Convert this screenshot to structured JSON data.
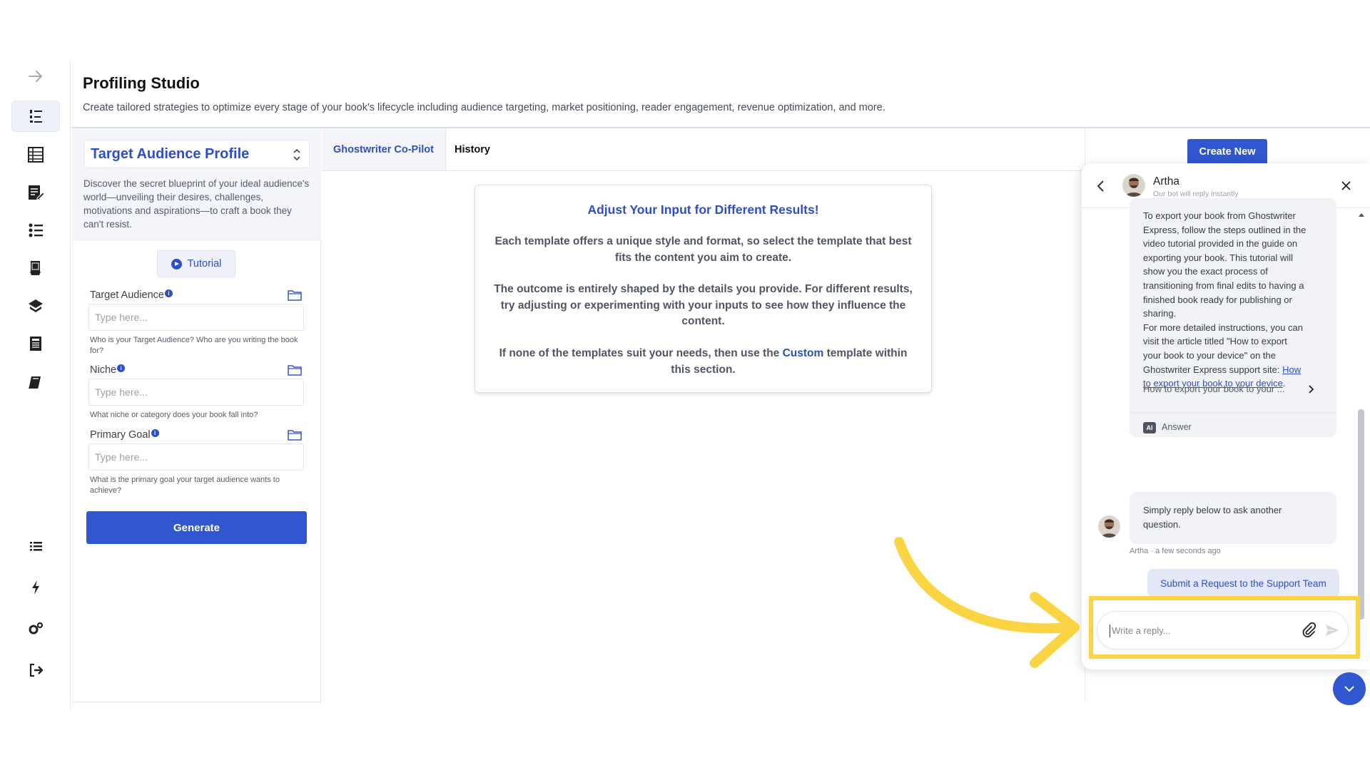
{
  "app": {
    "title": "Profiling Studio",
    "subtitle": "Create tailored strategies to optimize every stage of your book's lifecycle including audience targeting, market positioning, reader engagement, revenue optimization, and more."
  },
  "sidebar": {
    "items": [
      {
        "icon": "arrow-right-icon"
      },
      {
        "icon": "list-ordered-icon",
        "active": true
      },
      {
        "icon": "table-icon"
      },
      {
        "icon": "edit-document-icon"
      },
      {
        "icon": "list-numbered-icon"
      },
      {
        "icon": "book-stand-icon"
      },
      {
        "icon": "notebook-pencil-icon"
      },
      {
        "icon": "newspaper-icon"
      },
      {
        "icon": "book-icon"
      },
      {
        "icon": "list-icon"
      },
      {
        "icon": "lightning-icon"
      },
      {
        "icon": "cogs-icon"
      },
      {
        "icon": "logout-icon"
      }
    ]
  },
  "profile": {
    "selected": "Target Audience Profile",
    "description": "Discover the secret blueprint of your ideal audience's world—unveiling their desires, challenges, motivations and aspirations—to craft a book they can't resist.",
    "tutorial_label": "Tutorial",
    "fields": [
      {
        "label": "Target Audience",
        "placeholder": "Type here...",
        "help": "Who is your Target Audience? Who are you writing the book for?"
      },
      {
        "label": "Niche",
        "placeholder": "Type here...",
        "help": "What niche or category does your book fall into?"
      },
      {
        "label": "Primary Goal",
        "placeholder": "Type here...",
        "help": "What is the primary goal your target audience wants to achieve?"
      }
    ],
    "generate_label": "Generate"
  },
  "tabs": {
    "copilot": "Ghostwriter Co-Pilot",
    "history": "History"
  },
  "info_card": {
    "heading": "Adjust Your Input for Different Results!",
    "para1": "Each template offers a unique style and format, so select the template that best fits the content you aim to create.",
    "para2": "The outcome is entirely shaped by the details you provide. For different results, try adjusting or experimenting with your inputs to see how they influence the content.",
    "para3_before": "If none of the templates suit your needs, then use the ",
    "para3_link": "Custom",
    "para3_after": " template within this section."
  },
  "create_new_label": "Create New",
  "chat": {
    "agent_name": "Artha",
    "agent_status": "Our bot will reply instantly",
    "message_text": "To export your book from Ghostwriter Express, follow the steps outlined in the video tutorial provided in the guide on exporting your book. This tutorial will show you the exact process of transitioning from final edits to having a finished book ready for publishing or sharing.",
    "message_text2": "For more detailed instructions, you can visit the article titled \"How to export your book to your device\" on the Ghostwriter Express support site: ",
    "message_link": "How to export your book to your device",
    "message_link_end": ".",
    "source_title": "How to export your book to your ...",
    "ai_badge": "AI",
    "answer_label": "Answer",
    "followup": "Simply reply below to ask another question.",
    "meta": "Artha · a few seconds ago",
    "submit_label": "Submit a Request to the Support Team",
    "reply_placeholder": "Write a reply..."
  },
  "colors": {
    "accent": "#3057cf",
    "highlight": "#fbd443"
  }
}
